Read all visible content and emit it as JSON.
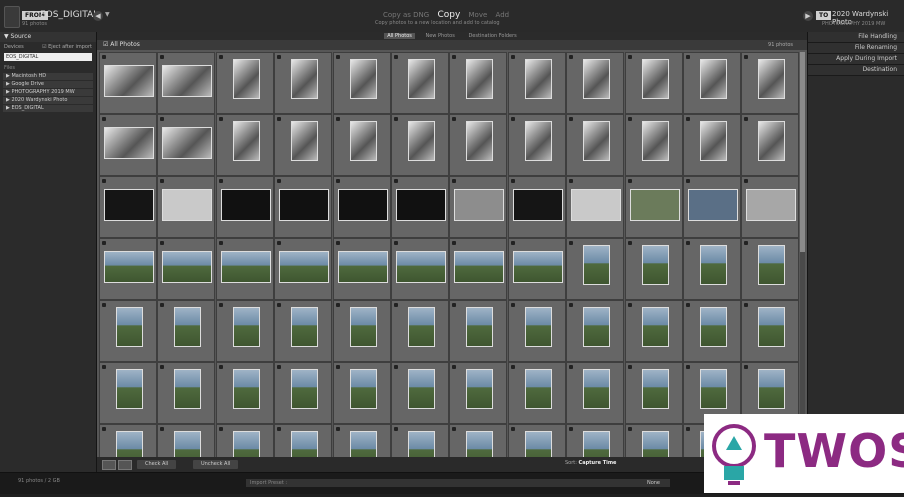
{
  "header": {
    "from_tag": "FROM",
    "source_name": "EOS_DIGITAL",
    "source_sub": "91 photos",
    "modes": [
      "Copy as DNG",
      "Copy",
      "Move",
      "Add"
    ],
    "active_mode": "Copy",
    "mode_description": "Copy photos to a new location and add to catalog",
    "to_tag": "TO",
    "destination_name": "2020 Wardynski Photo",
    "destination_sub": "PHOTOGRAPHY 2019 MW"
  },
  "left_panel": {
    "title": "Source",
    "devices_label": "Devices",
    "eject_label": "Eject after import",
    "device_field": "EOS_DIGITAL",
    "files_label": "Files",
    "volumes": [
      "Macintosh HD",
      "Google Drive",
      "PHOTOGRAPHY 2019 MW",
      "2020 Wardynski Photo",
      "EOS_DIGITAL"
    ]
  },
  "filter_bar": {
    "items": [
      "All Photos",
      "New Photos",
      "Destination Folders"
    ],
    "active": "All Photos"
  },
  "grid": {
    "title": "All Photos",
    "count": "91 photos"
  },
  "right_panel": {
    "items": [
      "File Handling",
      "File Renaming",
      "Apply During Import",
      "Destination"
    ]
  },
  "toolbar": {
    "check_all": "Check All",
    "uncheck_all": "Uncheck All",
    "sort_label": "Sort:",
    "sort_value": "Capture Time"
  },
  "status": {
    "left_text": "91 photos / 2 GB",
    "preset_label": "Import Preset :",
    "preset_value": "None"
  },
  "watermark": {
    "text": "TWOS",
    "colors": {
      "accent": "#8c2a82",
      "bulb": "#2aa6a6"
    }
  }
}
